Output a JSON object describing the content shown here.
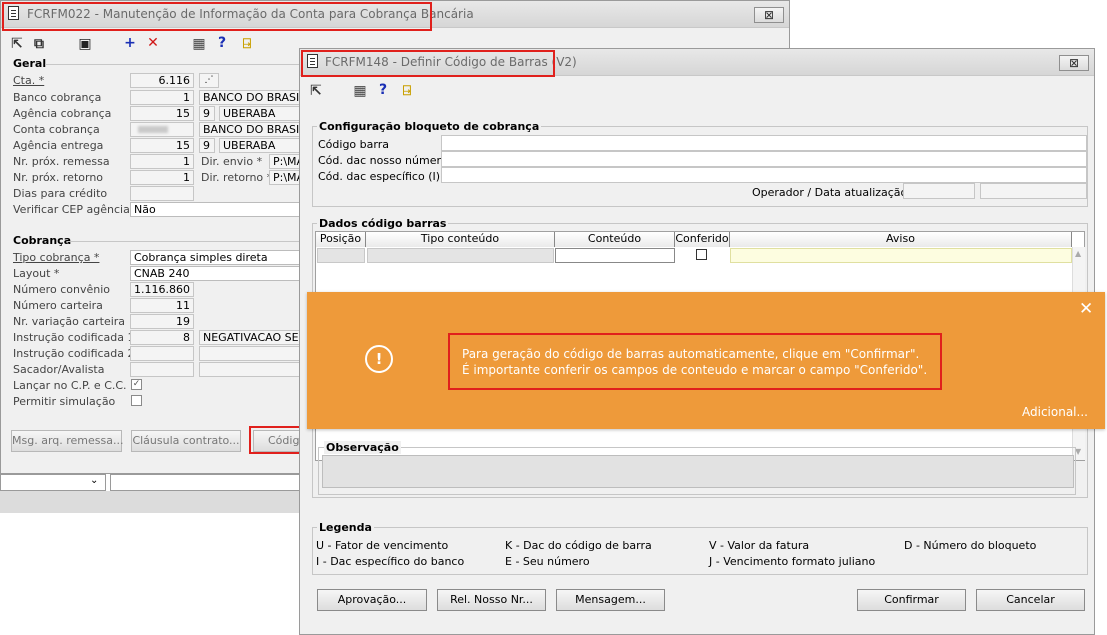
{
  "back_window": {
    "title": "FCRFM022 - Manutenção de Informação da Conta para Cobrança Bancária",
    "close_label": "⊠",
    "groups": {
      "geral": "Geral",
      "cobranca": "Cobrança"
    },
    "fields": {
      "cta": {
        "label": "Cta. *",
        "value": "6.116"
      },
      "banco": {
        "label": "Banco cobrança",
        "value": "1",
        "desc": "BANCO DO BRASIL"
      },
      "agencia": {
        "label": "Agência cobrança",
        "value": "15",
        "dv": "9",
        "desc": "UBERABA"
      },
      "conta": {
        "label": "Conta cobrança",
        "desc": "BANCO DO BRASIL"
      },
      "agencia_entrega": {
        "label": "Agência entrega",
        "value": "15",
        "dv": "9",
        "desc": "UBERABA"
      },
      "nr_remessa": {
        "label": "Nr. próx. remessa",
        "value": "1",
        "dir_label": "Dir. envio *",
        "dir_value": "P:\\MA"
      },
      "nr_retorno": {
        "label": "Nr. próx. retorno",
        "value": "1",
        "dir_label": "Dir. retorno *",
        "dir_value": "P:\\MA"
      },
      "dias_credito": {
        "label": "Dias para crédito",
        "value": ""
      },
      "verificar_cep": {
        "label": "Verificar CEP agência",
        "value": "Não"
      },
      "tipo_cobranca": {
        "label": "Tipo cobrança *",
        "value": "Cobrança simples direta"
      },
      "layout": {
        "label": "Layout *",
        "value": "CNAB 240"
      },
      "numero_convenio": {
        "label": "Número convênio",
        "value": "1.116.860"
      },
      "numero_carteira": {
        "label": "Número carteira",
        "value": "11"
      },
      "variacao_carteira": {
        "label": "Nr. variação carteira",
        "value": "19"
      },
      "instrucao1": {
        "label": "Instrução codificada 1",
        "value": "8",
        "desc": "NEGATIVACAO SEM"
      },
      "instrucao2": {
        "label": "Instrução codificada 2",
        "value": ""
      },
      "sacador": {
        "label": "Sacador/Avalista",
        "value": ""
      },
      "lancar_cp": {
        "label": "Lançar no C.P. e C.C.",
        "checked": true
      },
      "permitir_simulacao": {
        "label": "Permitir simulação",
        "checked": false
      }
    },
    "buttons": {
      "msg_arq_remessa": "Msg. arq. remessa...",
      "clausula_contrato": "Cláusula contrato...",
      "codigo": "Códig"
    }
  },
  "front_window": {
    "title": "FCRFM148 - Definir Código de Barras (V2)",
    "close_label": "⊠",
    "config_group": {
      "title": "Configuração bloqueto de cobrança",
      "codigo_barra": "Código barra",
      "cod_dac_nosso_numero": "Cód. dac nosso número",
      "cod_dac_especifico": "Cód. dac específico (I)",
      "operador_label": "Operador / Data atualização"
    },
    "dados_group": {
      "title": "Dados código barras",
      "columns": [
        "Posição",
        "Tipo conteúdo",
        "Conteúdo",
        "Conferido",
        "Aviso"
      ]
    },
    "observacao": "Observação",
    "legenda": {
      "title": "Legenda",
      "items": [
        "U - Fator de vencimento",
        "K - Dac do código de barra",
        "V - Valor da fatura",
        "D - Número do bloqueto",
        "I - Dac específico do banco",
        "E - Seu número",
        "J - Vencimento formato juliano"
      ]
    },
    "buttons": {
      "aprovacao": "Aprovação...",
      "rel_nosso_nr": "Rel. Nosso Nr...",
      "mensagem": "Mensagem...",
      "confirmar": "Confirmar",
      "cancelar": "Cancelar"
    }
  },
  "toast": {
    "line1": "Para geração do código de barras automaticamente, clique em \"Confirmar\".",
    "line2": "É importante conferir os campos de conteudo e marcar o campo \"Conferido\".",
    "link": "Adicional...",
    "close": "✕",
    "icon": "!",
    "color": "#ee9a3a"
  },
  "icons": [
    "exit-icon",
    "copy-icon",
    "save-icon",
    "add-icon",
    "delete-icon",
    "calculator-icon",
    "help-icon",
    "door-exit-icon"
  ]
}
